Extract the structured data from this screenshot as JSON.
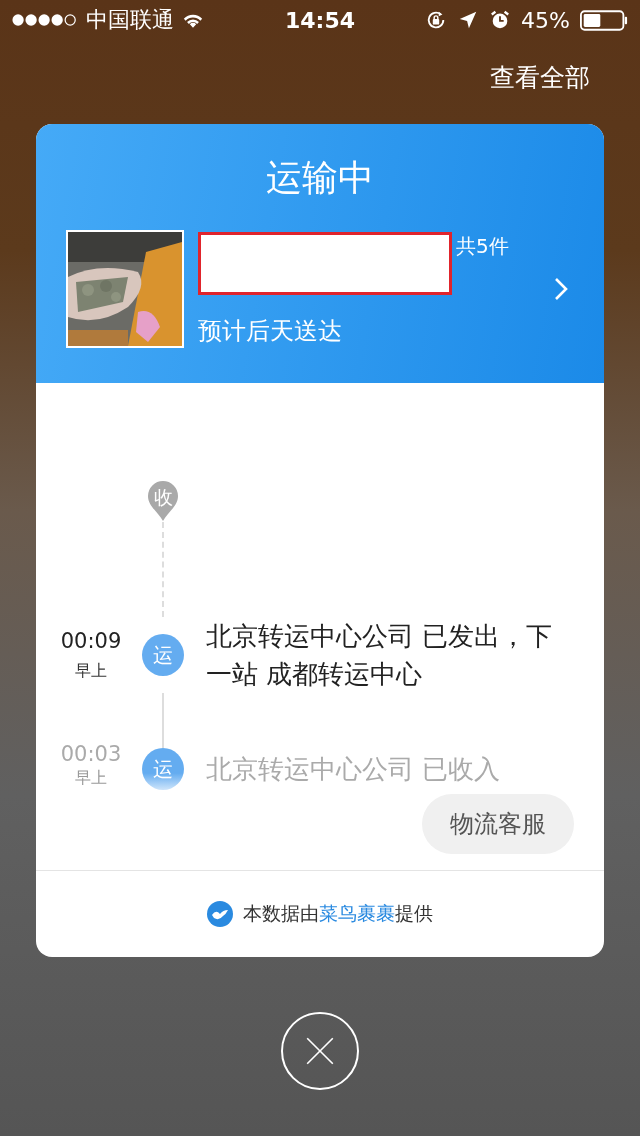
{
  "status_bar": {
    "carrier": "中国联通",
    "time": "14:54",
    "battery": "45%"
  },
  "top_link": "查看全部",
  "card": {
    "title": "运输中",
    "package": {
      "count": "共5件",
      "eta": "预计后天送达"
    },
    "timeline": {
      "start_marker": "收",
      "events": [
        {
          "time": "00:09",
          "period": "早上",
          "badge": "运",
          "text": "北京转运中心公司 已发出，下一站 成都转运中心",
          "faded": false
        },
        {
          "time": "00:03",
          "period": "早上",
          "badge": "运",
          "text": "北京转运中心公司 已收入",
          "faded": true
        }
      ]
    },
    "service_button": "物流客服",
    "footer": {
      "before": "本数据由",
      "link": "菜鸟裹裹",
      "after": "提供"
    }
  }
}
